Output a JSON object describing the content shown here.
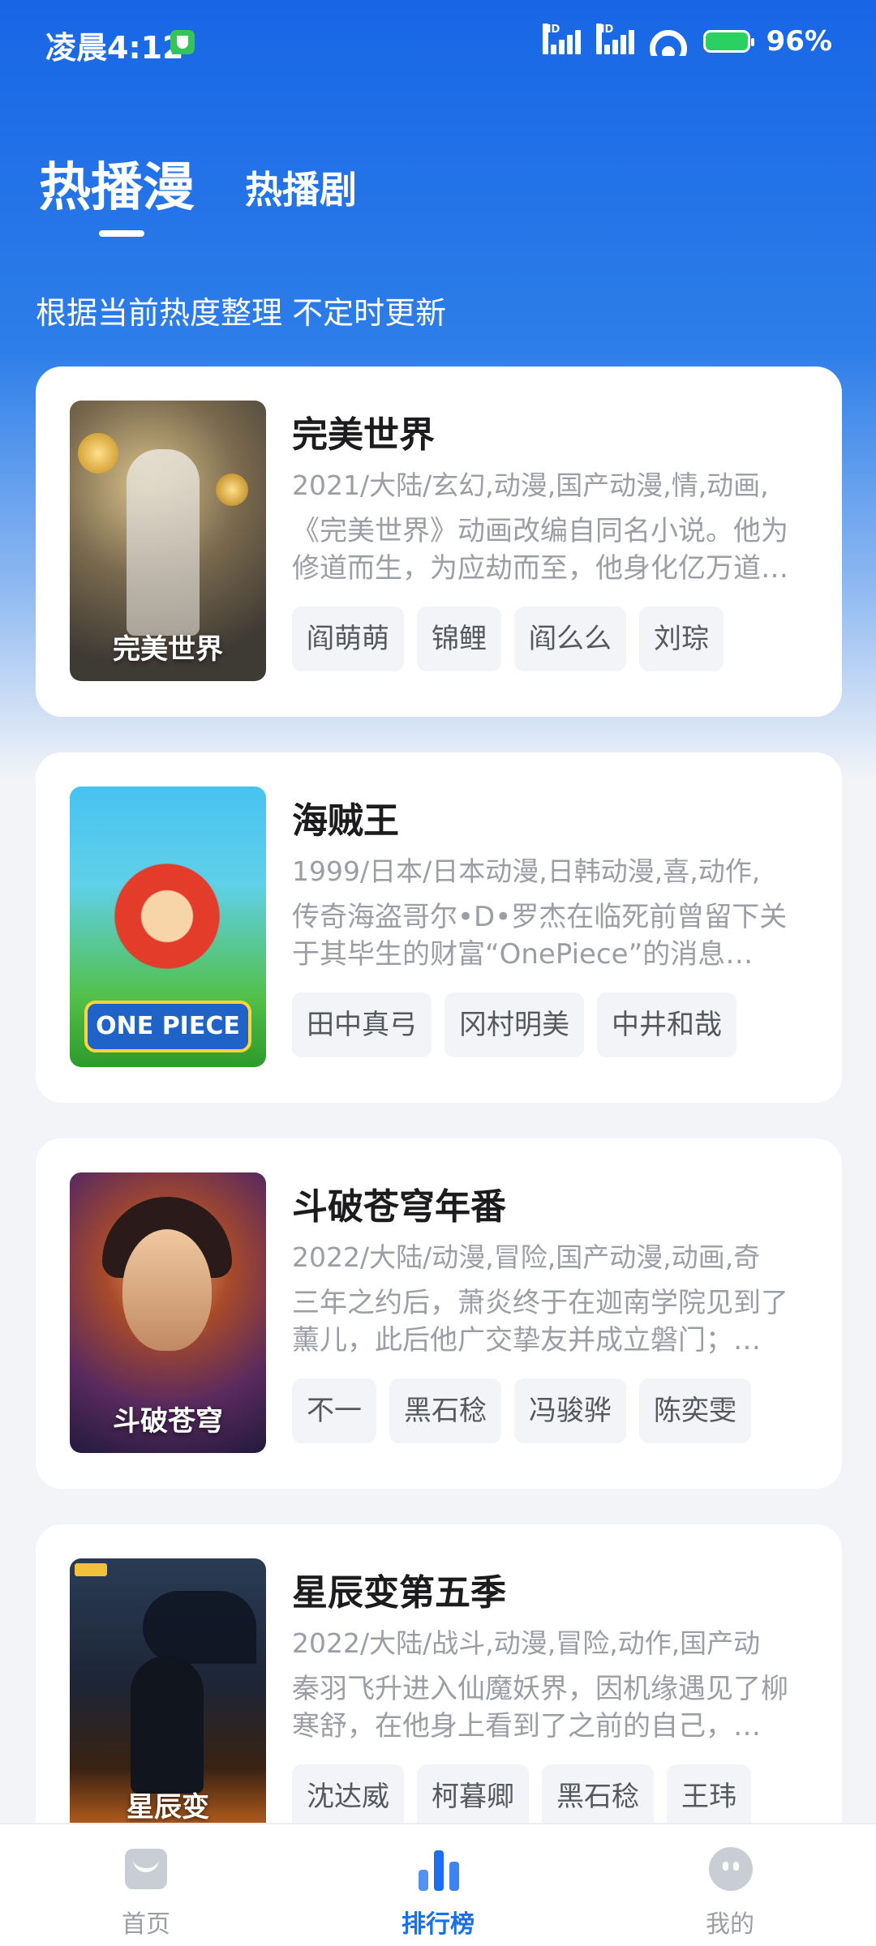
{
  "status_bar": {
    "time": "凌晨4:12",
    "signal_label": "HD",
    "battery": "96%"
  },
  "tabs": [
    {
      "label": "热播漫",
      "active": true
    },
    {
      "label": "热播剧",
      "active": false
    }
  ],
  "subtitle": "根据当前热度整理 不定时更新",
  "items": [
    {
      "title": "完美世界",
      "meta": "2021/大陆/玄幻,动漫,国产动漫,情,动画,",
      "desc": "《完美世界》动画改编自同名小说。他为修道而生，为应劫而至，他身化亿万道身，掌控万物，…",
      "tags": [
        "阎萌萌",
        "锦鲤",
        "阎么么",
        "刘琮"
      ],
      "poster_text": "完美世界"
    },
    {
      "title": "海贼王",
      "meta": "1999/日本/日本动漫,日韩动漫,喜,动作,",
      "desc": "传奇海盗哥尔•D•罗杰在临死前曾留下关于其毕生的财富“OnePiece”的消息…",
      "tags": [
        "田中真弓",
        "冈村明美",
        "中井和哉"
      ],
      "poster_text": "ONE PIECE"
    },
    {
      "title": "斗破苍穹年番",
      "meta": "2022/大陆/动漫,冒险,国产动漫,动画,奇",
      "desc": "三年之约后，萧炎终于在迦南学院见到了薰儿，此后他广交挚友并成立磐门；…",
      "tags": [
        "不一",
        "黑石稔",
        "冯骏骅",
        "陈奕雯"
      ],
      "poster_text": "斗破苍穹"
    },
    {
      "title": "星辰变第五季",
      "meta": "2022/大陆/战斗,动漫,冒险,动作,国产动",
      "desc": "秦羽飞升进入仙魔妖界，因机缘遇见了柳寒舒，在他身上看到了之前的自己，…",
      "tags": [
        "沈达威",
        "柯暮卿",
        "黑石稔",
        "王玮"
      ],
      "poster_text": "星辰变"
    }
  ],
  "bottom_nav": [
    {
      "label": "首页",
      "icon": "home-icon",
      "active": false
    },
    {
      "label": "排行榜",
      "icon": "ranking-icon",
      "active": true
    },
    {
      "label": "我的",
      "icon": "profile-icon",
      "active": false
    }
  ],
  "colors": {
    "accent": "#1a6ef0",
    "hero_top": "#1866e6",
    "background": "#f2f4f7"
  }
}
